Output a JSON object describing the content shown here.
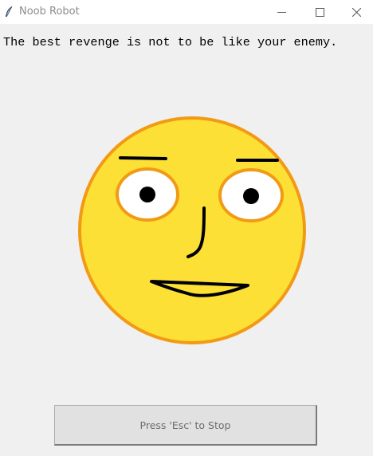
{
  "window": {
    "title": "Noob Robot",
    "controls": {
      "minimize": "minimize-icon",
      "maximize": "maximize-icon",
      "close": "close-icon"
    }
  },
  "quote": "The best revenge is not to be like your enemy.",
  "stop_button": {
    "label": "Press 'Esc' to Stop"
  },
  "colors": {
    "face_fill": "#fde035",
    "face_outline": "#f29a16",
    "eye_white": "#ffffff",
    "features": "#000000",
    "background": "#f0f0f0"
  }
}
